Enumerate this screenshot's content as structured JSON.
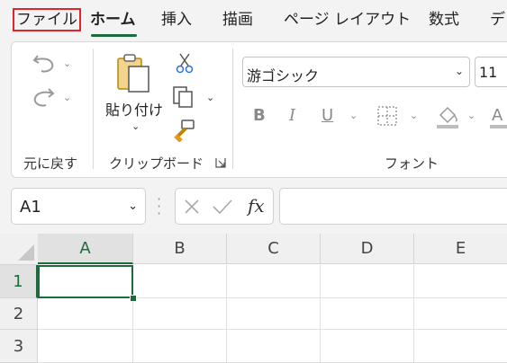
{
  "menu": {
    "items": [
      "ファイル",
      "ホーム",
      "挿入",
      "描画",
      "ページ レイアウト",
      "数式",
      "デ"
    ]
  },
  "ribbon": {
    "undo_group_label": "元に戻す",
    "clipboard": {
      "paste_label": "貼り付け",
      "group_label": "クリップボード"
    },
    "font": {
      "font_name": "游ゴシック",
      "font_size": "11",
      "group_label": "フォント",
      "bold": "B",
      "italic": "I",
      "underline": "U",
      "font_color": "A"
    }
  },
  "formula_bar": {
    "name_box": "A1",
    "fx": "fx",
    "formula": ""
  },
  "sheet": {
    "columns": [
      "A",
      "B",
      "C",
      "D",
      "E"
    ],
    "rows": [
      "1",
      "2",
      "3"
    ],
    "active_cell": "A1"
  },
  "colors": {
    "accent": "#1d6b3b",
    "highlight_box": "#e0242b"
  }
}
